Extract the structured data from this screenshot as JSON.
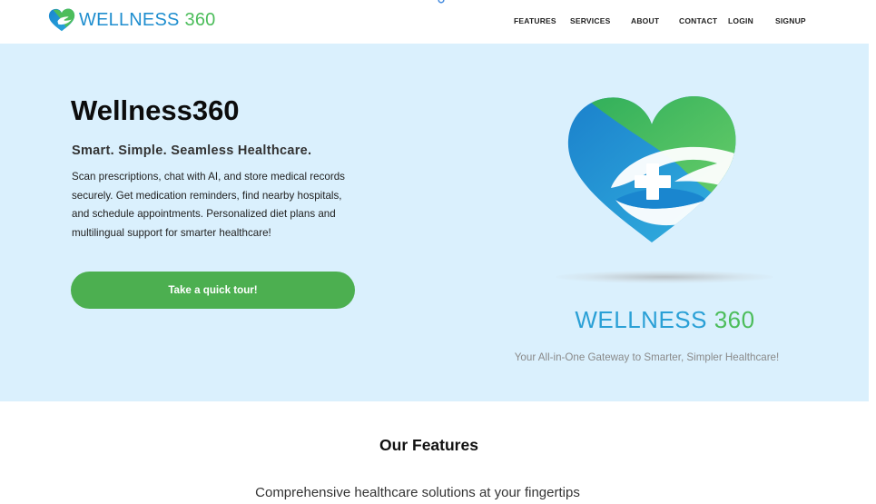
{
  "header": {
    "logo_word": "WELLNESS",
    "logo_number": "360",
    "nav": [
      "FEATURES",
      "SERVICES",
      "ABOUT",
      "CONTACT",
      "LOGIN",
      "SIGNUP"
    ]
  },
  "hero": {
    "title": "Wellness360",
    "tagline": "Smart. Simple. Seamless Healthcare.",
    "description": "Scan prescriptions, chat with AI, and store medical records securely. Get medication reminders, find nearby hospitals, and schedule appointments. Personalized diet plans and multilingual support for smarter healthcare!",
    "cta_label": "Take a quick tour!",
    "brand_word": "WELLNESS",
    "brand_number": "360",
    "brand_subtitle": "Your All-in-One Gateway to Smarter, Simpler Healthcare!"
  },
  "features": {
    "title": "Our Features",
    "subtitle": "Comprehensive healthcare solutions at your fingertips"
  },
  "colors": {
    "hero_background": "#daf0fd",
    "brand_blue": "#2aa0d6",
    "brand_green": "#4cbd5b",
    "cta_green": "#4caf50"
  },
  "icons": {
    "logo": "heart-hand-cross-icon",
    "hero_image": "heart-hand-cross-icon"
  }
}
